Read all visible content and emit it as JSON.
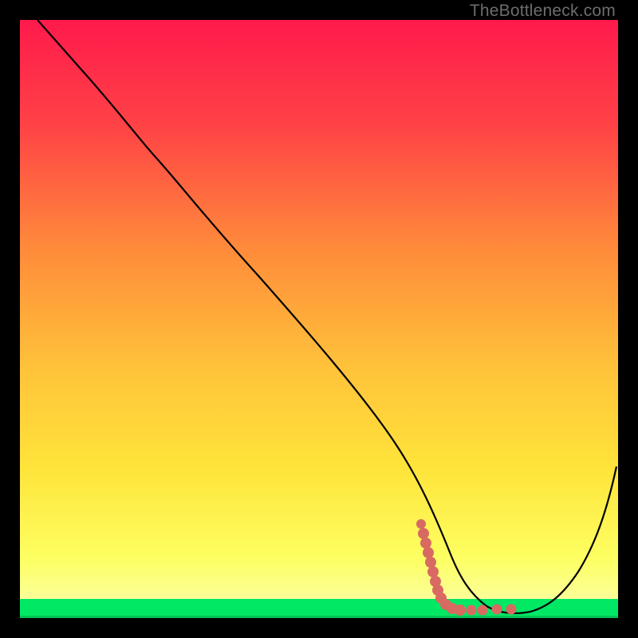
{
  "watermark": "TheBottleneck.com",
  "chart_data": {
    "type": "line",
    "title": "",
    "xlabel": "",
    "ylabel": "",
    "xlim": [
      0,
      100
    ],
    "ylim": [
      0,
      100
    ],
    "grid": false,
    "legend": false,
    "background_gradient": {
      "top": "#ff1a4c",
      "mid1": "#ff8a3b",
      "mid2": "#ffe43a",
      "mid3": "#fdff62",
      "bottom_band": "#00e864"
    },
    "series": [
      {
        "name": "bottleneck-curve",
        "color": "#000000",
        "x": [
          3,
          10,
          22,
          30,
          40,
          50,
          60,
          66,
          70,
          74,
          78,
          82,
          86,
          90,
          94,
          99.5
        ],
        "y": [
          100,
          92,
          78,
          70,
          57,
          44,
          31,
          22,
          14,
          7,
          3,
          1,
          1,
          4,
          12,
          26
        ]
      }
    ],
    "annotations": [
      {
        "name": "letter-L-marker",
        "color": "#d86a62",
        "shape": "dotted-L",
        "approx_position": {
          "x_start": 67,
          "x_end": 82,
          "y_range": [
            0.5,
            12
          ]
        }
      }
    ]
  }
}
